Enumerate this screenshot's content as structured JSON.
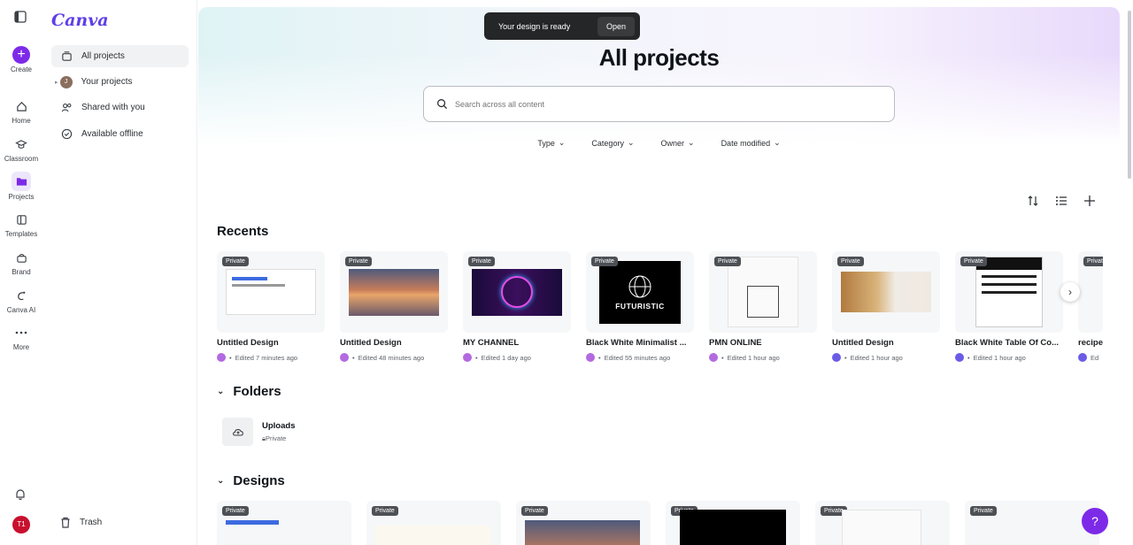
{
  "app": {
    "logo": "Canva"
  },
  "rail": {
    "items": [
      {
        "label": "Create"
      },
      {
        "label": "Home"
      },
      {
        "label": "Classroom"
      },
      {
        "label": "Projects"
      },
      {
        "label": "Templates"
      },
      {
        "label": "Brand"
      },
      {
        "label": "Canva AI"
      },
      {
        "label": "More"
      }
    ],
    "avatar_initials": "T1"
  },
  "sidebar": {
    "items": [
      {
        "label": "All projects"
      },
      {
        "label": "Your projects",
        "initial": "J"
      },
      {
        "label": "Shared with you"
      },
      {
        "label": "Available offline"
      }
    ],
    "trash_label": "Trash"
  },
  "toast": {
    "message": "Your design is ready",
    "action": "Open"
  },
  "main": {
    "title": "All projects",
    "search_placeholder": "Search across all content",
    "filters": [
      "Type",
      "Category",
      "Owner",
      "Date modified"
    ]
  },
  "recents": {
    "heading": "Recents",
    "badge": "Private",
    "items": [
      {
        "title": "Untitled Design",
        "meta": "Edited 7 minutes ago"
      },
      {
        "title": "Untitled Design",
        "meta": "Edited 48 minutes ago"
      },
      {
        "title": "MY CHANNEL",
        "meta": "Edited 1 day ago"
      },
      {
        "title": "Black White Minimalist ...",
        "meta": "Edited 55 minutes ago",
        "thumb_text": "FUTURISTIC"
      },
      {
        "title": "PMN ONLINE",
        "meta": "Edited 1 hour ago"
      },
      {
        "title": "Untitled Design",
        "meta": "Edited 1 hour ago"
      },
      {
        "title": "Black White Table Of Co...",
        "meta": "Edited 1 hour ago"
      },
      {
        "title": "recipe",
        "meta": "Ed"
      }
    ]
  },
  "folders": {
    "heading": "Folders",
    "items": [
      {
        "name": "Uploads",
        "sub": "Private"
      }
    ]
  },
  "designs": {
    "heading": "Designs",
    "badge": "Private"
  },
  "help_label": "?"
}
